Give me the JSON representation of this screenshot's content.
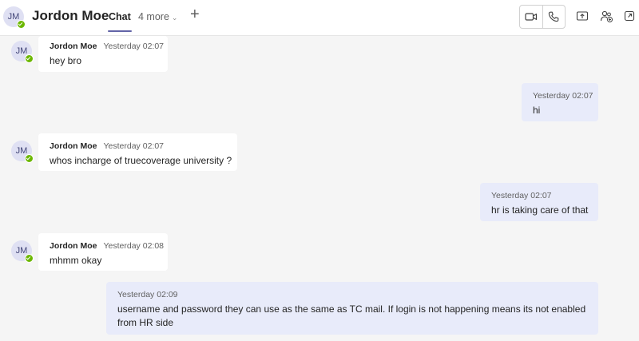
{
  "header": {
    "avatar_initials": "JM",
    "title": "Jordon Moe",
    "tab_chat": "Chat",
    "tab_more": "4 more",
    "add_tab": "+",
    "icons": [
      "video-call-icon",
      "audio-call-icon",
      "share-screen-icon",
      "add-people-icon",
      "pop-out-icon"
    ]
  },
  "colors": {
    "accent": "#6264a7",
    "presence": "#6bb700",
    "my_bubble": "#e8ebfa",
    "their_bubble": "#ffffff",
    "background": "#f5f5f5"
  },
  "messages": [
    {
      "sender": "them",
      "author": "Jordon Moe",
      "initials": "JM",
      "time": "Yesterday 02:07",
      "text": "hey bro"
    },
    {
      "sender": "me",
      "time": "Yesterday 02:07",
      "text": "hi"
    },
    {
      "sender": "them",
      "author": "Jordon Moe",
      "initials": "JM",
      "time": "Yesterday 02:07",
      "text": "whos incharge of truecoverage university ?"
    },
    {
      "sender": "me",
      "time": "Yesterday 02:07",
      "text": "hr is taking care of that"
    },
    {
      "sender": "them",
      "author": "Jordon Moe",
      "initials": "JM",
      "time": "Yesterday 02:08",
      "text": "mhmm okay"
    },
    {
      "sender": "me",
      "time": "Yesterday 02:09",
      "text": "username and password they can use as the same as TC mail. If login is not happening means its not enabled from HR side"
    }
  ]
}
